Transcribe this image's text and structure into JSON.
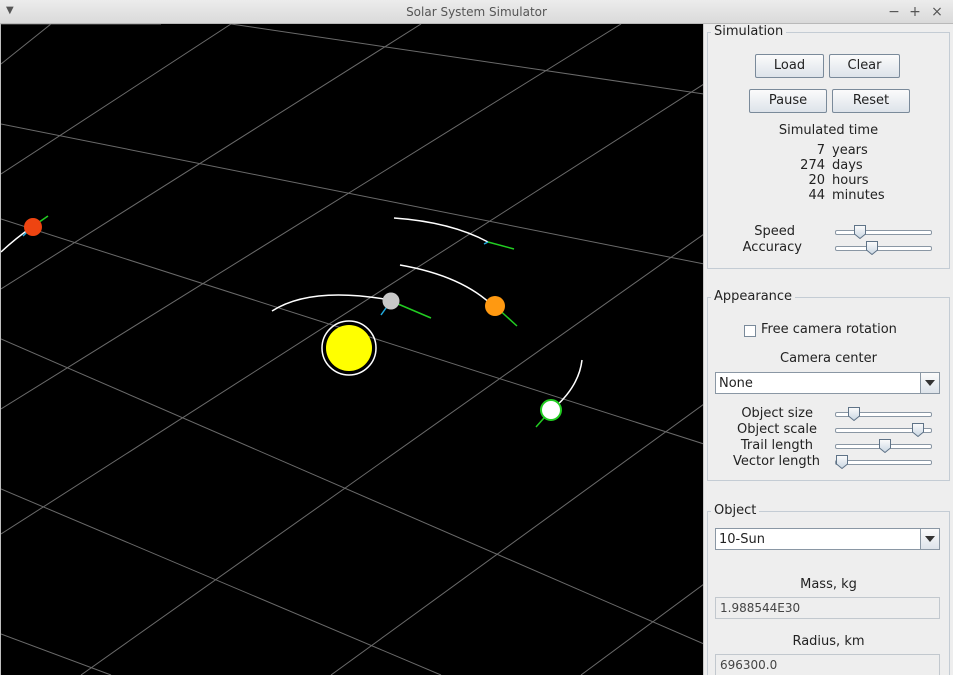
{
  "window": {
    "title": "Solar System Simulator"
  },
  "colors": {
    "background": "#000000",
    "grid": "#6a6a6a",
    "trail": "#ffffff",
    "sun": "#ffff00",
    "velocity_vector": "#22cc22",
    "accel_vector": "#22aadd"
  },
  "simulation": {
    "heading": "Simulation",
    "load": "Load",
    "clear": "Clear",
    "pause": "Pause",
    "reset": "Reset",
    "time_heading": "Simulated time",
    "years": {
      "value": "7",
      "unit": "years"
    },
    "days": {
      "value": "274",
      "unit": "days"
    },
    "hours": {
      "value": "20",
      "unit": "hours"
    },
    "minutes": {
      "value": "44",
      "unit": "minutes"
    },
    "speed_label": "Speed",
    "speed_level": 0.26,
    "accuracy_label": "Accuracy",
    "accuracy_level": 0.38
  },
  "appearance": {
    "heading": "Appearance",
    "free_camera_label": "Free camera rotation",
    "free_camera_checked": false,
    "camera_center_label": "Camera center",
    "camera_center_value": "None",
    "object_size_label": "Object size",
    "object_size_level": 0.2,
    "object_scale_label": "Object scale",
    "object_scale_level": 0.86,
    "trail_length_label": "Trail length",
    "trail_length_level": 0.52,
    "vector_length_label": "Vector length",
    "vector_length_level": 0.07
  },
  "object": {
    "heading": "Object",
    "selected": "10-Sun",
    "mass_label": "Mass, kg",
    "mass_value": "1.988544E30",
    "radius_label": "Radius, km",
    "radius_value": "696300.0"
  },
  "bodies": [
    {
      "name": "sun",
      "color": "#ffff00"
    },
    {
      "name": "red-planet",
      "color": "#ee4411"
    },
    {
      "name": "grey-planet",
      "color": "#c8c8c8"
    },
    {
      "name": "orange-planet",
      "color": "#ff9911"
    },
    {
      "name": "selected-planet",
      "color": "#ffffff"
    }
  ]
}
